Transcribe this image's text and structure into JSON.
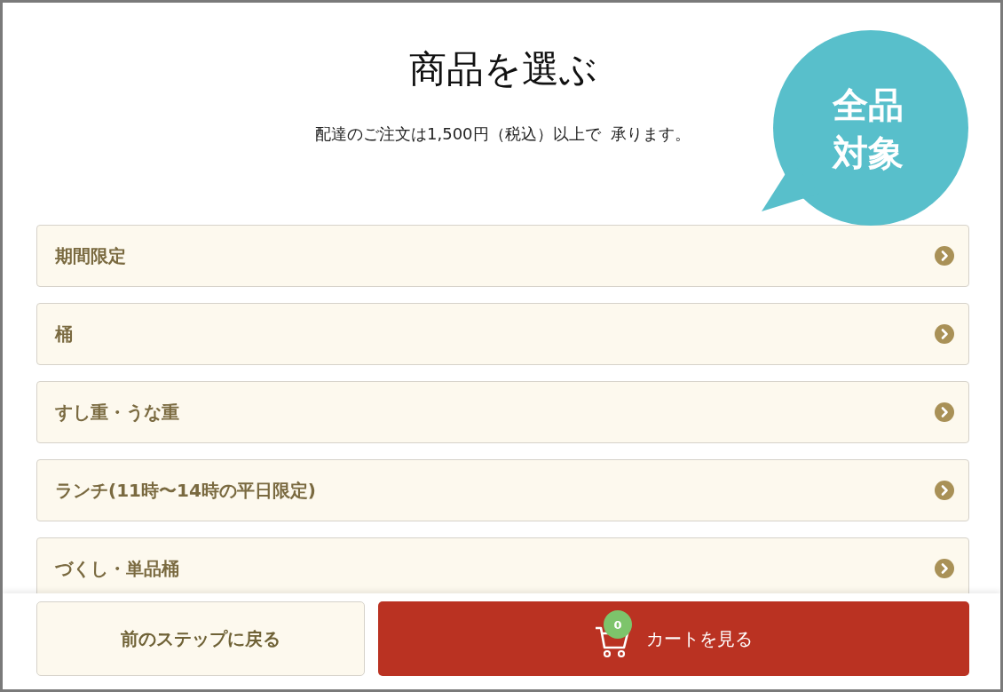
{
  "title": "商品を選ぶ",
  "notice": "配達のご注文は1,500円（税込）以上で  承ります。",
  "bubble": {
    "lines": [
      "全品",
      "対象"
    ]
  },
  "categories": [
    {
      "label": "期間限定"
    },
    {
      "label": "桶"
    },
    {
      "label": "すし重・うな重"
    },
    {
      "label": "ランチ(11時〜14時の平日限定)"
    },
    {
      "label": "づくし・単品桶"
    }
  ],
  "footer": {
    "back": "前のステップに戻る",
    "cart": "カートを見る",
    "cart_count": "0"
  }
}
